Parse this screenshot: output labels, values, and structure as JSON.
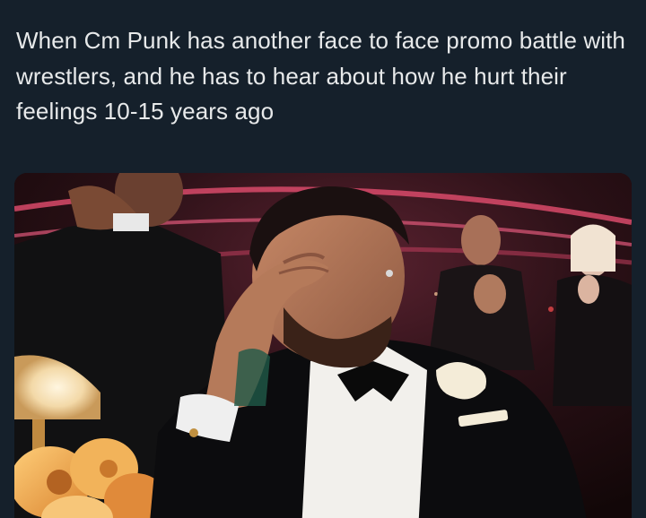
{
  "post": {
    "caption": "When Cm Punk has another face to face promo battle with wrestlers, and he has to hear about how he hurt their feelings 10-15 years ago"
  },
  "media": {
    "kind": "photo",
    "scene": "man in black tuxedo with hand over face in a theater audience, people applauding behind him",
    "colors": {
      "background": "#15202b",
      "text": "#e7e9ea",
      "stage_light": "#d84a6a",
      "theater_dark": "#1b0c0c"
    }
  }
}
